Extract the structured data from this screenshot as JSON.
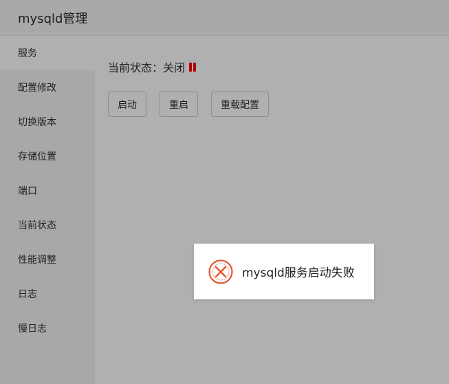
{
  "header": {
    "title": "mysqld管理"
  },
  "sidebar": {
    "items": [
      {
        "label": "服务",
        "active": true
      },
      {
        "label": "配置修改"
      },
      {
        "label": "切换版本"
      },
      {
        "label": "存储位置"
      },
      {
        "label": "端口"
      },
      {
        "label": "当前状态"
      },
      {
        "label": "性能调整"
      },
      {
        "label": "日志"
      },
      {
        "label": "慢日志"
      }
    ]
  },
  "main": {
    "status_label": "当前状态：",
    "status_value": "关闭",
    "status_icon": "pause-icon",
    "buttons": {
      "start": "启动",
      "restart": "重启",
      "reload": "重载配置"
    }
  },
  "toast": {
    "icon": "error-circle-icon",
    "message": "mysqld服务启动失败"
  },
  "colors": {
    "accent_red": "#b20000",
    "error_icon": "#e4572e",
    "background": "#b0b0b0",
    "sidebar": "#a8a8a8",
    "toast_bg": "#ffffff"
  }
}
